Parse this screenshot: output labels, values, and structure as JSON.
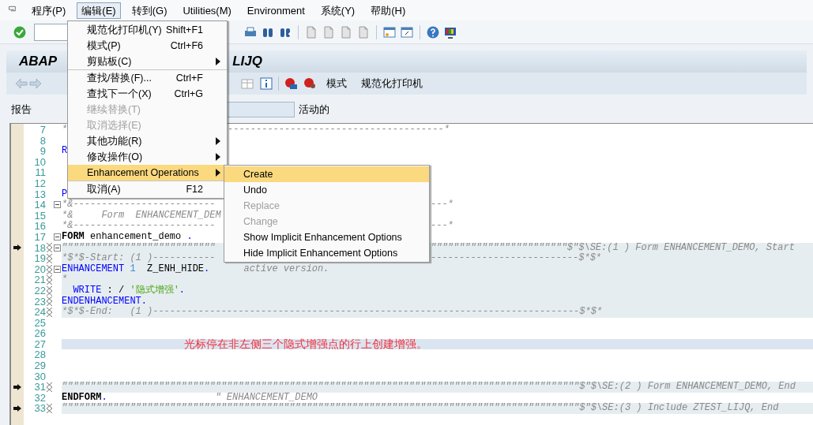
{
  "menu_bar": [
    {
      "label": "程序(P)",
      "selected": false
    },
    {
      "label": "编辑(E)",
      "selected": true
    },
    {
      "label": "转到(G)",
      "selected": false
    },
    {
      "label": "Utilities(M)",
      "selected": false
    },
    {
      "label": "Environment",
      "selected": false
    },
    {
      "label": "系统(Y)",
      "selected": false
    },
    {
      "label": "帮助(H)",
      "selected": false
    }
  ],
  "title": {
    "left": "ABAP",
    "right": "LIJQ"
  },
  "app_toolbar": {
    "buttons": [
      "模式",
      "规范化打印机"
    ]
  },
  "report_row": {
    "label": "报告",
    "status": "活动的"
  },
  "lines": [
    {
      "number": "7",
      "left": [
        {
          "text": "*",
          "kind": "comment"
        }
      ],
      "mid": [
        {
          "text": "--------------------------------------*",
          "kind": "comment"
        }
      ],
      "arrow": false,
      "fold": false,
      "marker": false,
      "enhancement": false,
      "cursor": false
    },
    {
      "number": "8",
      "arrow": false,
      "fold": false,
      "marker": false,
      "enhancement": false,
      "cursor": false
    },
    {
      "number": "9",
      "left": [
        {
          "text": "R",
          "kind": "keyword"
        }
      ],
      "arrow": false,
      "fold": false,
      "marker": false,
      "enhancement": false,
      "cursor": false
    },
    {
      "number": "10",
      "arrow": false,
      "fold": false,
      "marker": false,
      "enhancement": false,
      "cursor": false
    },
    {
      "number": "11",
      "arrow": false,
      "fold": false,
      "marker": false,
      "enhancement": false,
      "cursor": false
    },
    {
      "number": "12",
      "arrow": false,
      "fold": false,
      "marker": false,
      "enhancement": false,
      "cursor": false
    },
    {
      "number": "13",
      "left": [
        {
          "text": "P",
          "kind": "keyword"
        }
      ],
      "arrow": false,
      "fold": false,
      "marker": false,
      "enhancement": false,
      "cursor": false
    },
    {
      "number": "14",
      "left": [
        {
          "text": "*&-------------------------",
          "kind": "comment"
        }
      ],
      "right": [
        {
          "text": "---*",
          "kind": "comment"
        }
      ],
      "arrow": false,
      "fold": true,
      "marker": false,
      "enhancement": false,
      "cursor": false
    },
    {
      "number": "15",
      "left": [
        {
          "text": "*&     Form  ENHANCEMENT_DEM",
          "kind": "comment"
        }
      ],
      "arrow": false,
      "fold": false,
      "marker": false,
      "enhancement": false,
      "cursor": false
    },
    {
      "number": "16",
      "left": [
        {
          "text": "*&-------------------------",
          "kind": "comment"
        }
      ],
      "right": [
        {
          "text": "---*",
          "kind": "comment"
        }
      ],
      "arrow": false,
      "fold": false,
      "marker": false,
      "enhancement": false,
      "cursor": false
    },
    {
      "number": "17",
      "left": [
        {
          "text": "FORM",
          "kind": "bold"
        },
        {
          "text": " enhancement_demo ",
          "kind": "plain"
        },
        {
          "text": ".",
          "kind": "keyword"
        }
      ],
      "arrow": false,
      "fold": true,
      "marker": false,
      "enhancement": false,
      "cursor": false
    },
    {
      "number": "18",
      "left": [
        {
          "text": "\"\"\"\"\"\"\"\"\"\"\"\"\"\"\"\"\"\"\"\"\"\"\"\"\"\"\"",
          "kind": "comment"
        }
      ],
      "right": [
        {
          "text": "\"\"\"\"\"\"\"\"\"\"\"\"\"\"\"\"\"\"\"\"\"\"\"\"$\"$\\SE:(1 ) Form ENHANCEMENT_DEMO, Start",
          "kind": "comment"
        }
      ],
      "arrow": true,
      "fold": true,
      "marker": true,
      "enhancement": true,
      "cursor": false
    },
    {
      "number": "19",
      "left": [
        {
          "text": "*$*$-Start: (1 )-----------",
          "kind": "comment"
        }
      ],
      "right": [
        {
          "text": "--------------------------$*$*",
          "kind": "comment"
        }
      ],
      "arrow": false,
      "fold": false,
      "marker": true,
      "enhancement": true,
      "cursor": false
    },
    {
      "number": "20",
      "left": [
        {
          "text": "ENHANCEMENT",
          "kind": "keyword"
        },
        {
          "text": " 1",
          "kind": "number"
        },
        {
          "text": "  Z_ENH_HIDE",
          "kind": "plain"
        },
        {
          "text": ".",
          "kind": "keyword"
        },
        {
          "text": "      active version.",
          "kind": "comment"
        }
      ],
      "arrow": false,
      "fold": true,
      "marker": true,
      "enhancement": true,
      "cursor": false
    },
    {
      "number": "21",
      "left": [
        {
          "text": "*",
          "kind": "comment"
        }
      ],
      "arrow": false,
      "fold": false,
      "marker": true,
      "enhancement": true,
      "cursor": false
    },
    {
      "number": "22",
      "left": [
        {
          "text": "  WRITE",
          "kind": "keyword"
        },
        {
          "text": " : / ",
          "kind": "plain"
        },
        {
          "text": "'隐式增强'",
          "kind": "string"
        },
        {
          "text": ".",
          "kind": "keyword"
        }
      ],
      "arrow": false,
      "fold": false,
      "marker": true,
      "enhancement": true,
      "cursor": false
    },
    {
      "number": "23",
      "left": [
        {
          "text": "ENDENHANCEMENT.",
          "kind": "keyword"
        }
      ],
      "arrow": false,
      "fold": false,
      "marker": true,
      "enhancement": true,
      "cursor": false
    },
    {
      "number": "24",
      "left": [
        {
          "text": "*$*$-End:   (1 )---------------------------------------------------------------------------$*$*",
          "kind": "comment"
        }
      ],
      "arrow": false,
      "fold": false,
      "marker": true,
      "enhancement": true,
      "cursor": false
    },
    {
      "number": "25",
      "arrow": false,
      "fold": false,
      "marker": false,
      "enhancement": false,
      "cursor": false
    },
    {
      "number": "26",
      "arrow": false,
      "fold": false,
      "marker": false,
      "enhancement": false,
      "cursor": false
    },
    {
      "number": "27",
      "note": "光标停在非左侧三个隐式增强点的行上创建增强。",
      "arrow": false,
      "fold": false,
      "marker": false,
      "enhancement": false,
      "cursor": true
    },
    {
      "number": "28",
      "arrow": false,
      "fold": false,
      "marker": false,
      "enhancement": false,
      "cursor": false
    },
    {
      "number": "29",
      "arrow": false,
      "fold": false,
      "marker": false,
      "enhancement": false,
      "cursor": false
    },
    {
      "number": "30",
      "arrow": false,
      "fold": false,
      "marker": false,
      "enhancement": false,
      "cursor": false
    },
    {
      "number": "31",
      "left": [
        {
          "text": "\"\"\"\"\"\"\"\"\"\"\"\"\"\"\"\"\"\"\"\"\"\"\"\"\"\"\"\"\"\"\"\"\"\"\"\"\"\"\"\"\"\"\"\"\"\"\"\"\"\"\"\"\"\"\"\"\"\"\"\"\"\"\"\"\"\"\"\"\"\"\"\"\"\"\"\"\"\"\"\"\"\"\"\"\"\"\"\"\"\"\"$\"$\\SE:(2 ) Form ENHANCEMENT_DEMO, End",
          "kind": "comment"
        }
      ],
      "arrow": true,
      "fold": false,
      "marker": true,
      "enhancement": true,
      "cursor": false
    },
    {
      "number": "32",
      "left": [
        {
          "text": "ENDFORM",
          "kind": "bold"
        },
        {
          "text": ".",
          "kind": "keyword"
        },
        {
          "text": "                   \" ENHANCEMENT_DEMO",
          "kind": "comment"
        }
      ],
      "arrow": false,
      "fold": false,
      "marker": false,
      "enhancement": false,
      "cursor": false
    },
    {
      "number": "33",
      "left": [
        {
          "text": "\"\"\"\"\"\"\"\"\"\"\"\"\"\"\"\"\"\"\"\"\"\"\"\"\"\"\"\"\"\"\"\"\"\"\"\"\"\"\"\"\"\"\"\"\"\"\"\"\"\"\"\"\"\"\"\"\"\"\"\"\"\"\"\"\"\"\"\"\"\"\"\"\"\"\"\"\"\"\"\"\"\"\"\"\"\"\"\"\"\"\"$\"$\\SE:(3 ) Include ZTEST_LIJQ, End",
          "kind": "comment"
        }
      ],
      "arrow": true,
      "fold": false,
      "marker": true,
      "enhancement": true,
      "cursor": false
    }
  ],
  "edit_menu": [
    {
      "kind": "item",
      "label": "规范化打印机(Y)",
      "shortcut": "Shift+F1",
      "submenu": false,
      "disabled": false,
      "selected": false
    },
    {
      "kind": "item",
      "label": "模式(P)",
      "shortcut": "Ctrl+F6",
      "submenu": false,
      "disabled": false,
      "selected": false
    },
    {
      "kind": "item",
      "label": "剪贴板(C)",
      "submenu": true,
      "disabled": false,
      "selected": false
    },
    {
      "kind": "separator"
    },
    {
      "kind": "item",
      "label": "查找/替换(F)...",
      "shortcut": "Ctrl+F",
      "submenu": false,
      "disabled": false,
      "selected": false
    },
    {
      "kind": "item",
      "label": "查找下一个(X)",
      "shortcut": "Ctrl+G",
      "submenu": false,
      "disabled": false,
      "selected": false
    },
    {
      "kind": "item",
      "label": "继续替换(T)",
      "submenu": false,
      "disabled": true,
      "selected": false
    },
    {
      "kind": "item",
      "label": "取消选择(E)",
      "submenu": false,
      "disabled": true,
      "selected": false
    },
    {
      "kind": "item",
      "label": "其他功能(R)",
      "submenu": true,
      "disabled": false,
      "selected": false
    },
    {
      "kind": "item",
      "label": "修改操作(O)",
      "submenu": true,
      "disabled": false,
      "selected": false
    },
    {
      "kind": "item",
      "label": "Enhancement Operations",
      "submenu": true,
      "disabled": false,
      "selected": true
    },
    {
      "kind": "separator"
    },
    {
      "kind": "item",
      "label": "取消(A)",
      "shortcut": "F12",
      "submenu": false,
      "disabled": false,
      "selected": false
    }
  ],
  "enhancement_submenu": [
    {
      "label": "Create",
      "disabled": false,
      "selected": true
    },
    {
      "label": "Undo",
      "disabled": false,
      "selected": false
    },
    {
      "label": "Replace",
      "disabled": true,
      "selected": false
    },
    {
      "label": "Change",
      "disabled": true,
      "selected": false
    },
    {
      "label": "Show Implicit Enhancement Options",
      "disabled": false,
      "selected": false
    },
    {
      "label": "Hide Implicit Enhancement Options",
      "disabled": false,
      "selected": false
    }
  ]
}
